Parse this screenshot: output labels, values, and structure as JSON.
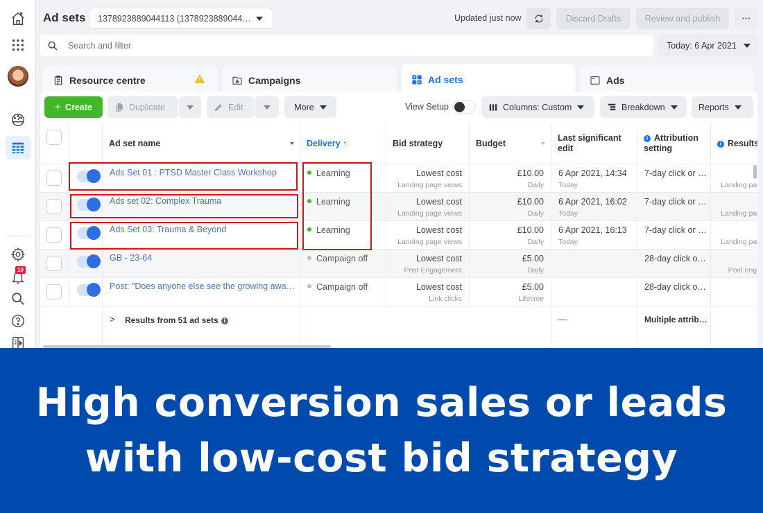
{
  "rail": {
    "icons": [
      "home-icon",
      "apps-grid-icon",
      "avatar",
      "dashboard-gauge-icon",
      "table-icon",
      "settings-gear-icon",
      "notifications-bell-icon",
      "search-icon",
      "help-icon",
      "panel-toggle-icon"
    ],
    "notification_count": "10"
  },
  "header": {
    "title": "Ad sets",
    "account_select": "1378923889044113 (1378923889044…",
    "updated_status": "Updated just now",
    "discard_label": "Discard Drafts",
    "publish_label": "Review and publish",
    "more_label": "···",
    "search_placeholder": "Search and filter",
    "date_range": "Today: 6 Apr 2021"
  },
  "tabs": [
    {
      "label": "Resource centre",
      "icon": "clipboard-icon",
      "warning": true
    },
    {
      "label": "Campaigns",
      "icon": "folder-icon"
    },
    {
      "label": "Ad sets",
      "icon": "grid-icon",
      "active": true
    },
    {
      "label": "Ads",
      "icon": "ad-window-icon"
    }
  ],
  "toolbar": {
    "create_label": "Create",
    "duplicate_label": "Duplicate",
    "edit_label": "Edit",
    "more_label": "More",
    "view_setup_label": "View Setup",
    "view_setup_on": false,
    "columns_label": "Columns: Custom",
    "breakdown_label": "Breakdown",
    "reports_label": "Reports"
  },
  "table": {
    "columns": {
      "name": "Ad set name",
      "delivery": "Delivery ↑",
      "bid": "Bid strategy",
      "budget": "Budget",
      "edit": "Last significant edit",
      "attribution": "Attribution setting",
      "results": "Results"
    },
    "rows": [
      {
        "name": "Ads Set 01 : PTSD Master Class Workshop",
        "delivery": "Learning",
        "delivery_color": "#42b72a",
        "bid": "Lowest cost",
        "bid_sub": "Landing page views",
        "budget": "£10.00",
        "budget_sub": "Daily",
        "edit": "6 Apr 2021, 14:34",
        "edit_sub": "Today",
        "attribution": "7-day click or …",
        "results_sub": "Landing page views",
        "highlighted": true,
        "on": true
      },
      {
        "name": "Ads set 02: Complex Trauma",
        "delivery": "Learning",
        "delivery_color": "#42b72a",
        "bid": "Lowest cost",
        "bid_sub": "Landing page views",
        "budget": "£10.00",
        "budget_sub": "Daily",
        "edit": "6 Apr 2021, 16:02",
        "edit_sub": "Today",
        "attribution": "7-day click or …",
        "results_sub": "Landing page views",
        "highlighted": true,
        "on": true
      },
      {
        "name": "Ads Set 03: Trauma & Beyond",
        "delivery": "Learning",
        "delivery_color": "#42b72a",
        "bid": "Lowest cost",
        "bid_sub": "Landing page views",
        "budget": "£10.00",
        "budget_sub": "Daily",
        "edit": "6 Apr 2021, 16:13",
        "edit_sub": "Today",
        "attribution": "7-day click or …",
        "results_sub": "Landing page views",
        "highlighted": true,
        "on": true
      },
      {
        "name": "GB - 23-64",
        "delivery": "Campaign off",
        "delivery_color": "#bcc0c4",
        "bid": "Lowest cost",
        "bid_sub": "Post Engagement",
        "budget": "£5.00",
        "budget_sub": "Daily",
        "edit": "",
        "edit_sub": "",
        "attribution": "28-day click o…",
        "results_sub": "Post engagement",
        "highlighted": false,
        "on": true
      },
      {
        "name": "Post: \"Does anyone else see the growing awa…",
        "delivery": "Campaign off",
        "delivery_color": "#bcc0c4",
        "bid": "Lowest cost",
        "bid_sub": "Link clicks",
        "budget": "£5.00",
        "budget_sub": "Lifetime",
        "edit": "",
        "edit_sub": "",
        "attribution": "28-day click o…",
        "results_sub": "",
        "highlighted": false,
        "on": true
      }
    ],
    "summary": {
      "label": "Results from 51 ad sets",
      "edit": "—",
      "attribution": "Multiple attrib…"
    }
  },
  "highlight_color": "#d0121b",
  "accent_color": "#1b74e4",
  "create_color": "#42b72a",
  "banner": {
    "line1": "High conversion sales or leads",
    "line2": "with low-cost bid strategy",
    "background": "#004aad"
  }
}
